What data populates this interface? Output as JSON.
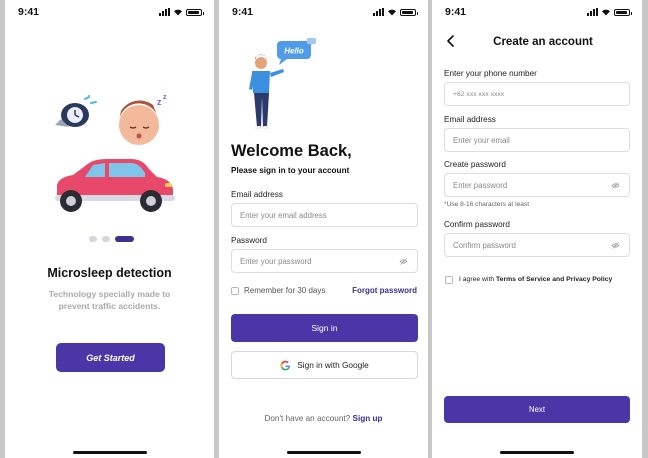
{
  "status_bar": {
    "time": "9:41"
  },
  "onboarding": {
    "title": "Microsleep detection",
    "description": "Technology specially made to prevent traffic accidents.",
    "cta_label": "Get Started",
    "page_count": 3,
    "active_page": 3
  },
  "signin": {
    "heading": "Welcome Back,",
    "subheading": "Please sign in to your account",
    "email_label": "Email address",
    "email_placeholder": "Enter your email address",
    "password_label": "Password",
    "password_placeholder": "Enter your password",
    "remember_label": "Remember for 30 days",
    "forgot_label": "Forgot password",
    "signin_label": "Sign in",
    "google_label": "Sign in with Google",
    "no_account_text": "Don't have an account?",
    "signup_label": "Sign up",
    "bubble_text": "Hello"
  },
  "create_account": {
    "heading": "Create an account",
    "phone_label": "Enter your phone number",
    "phone_placeholder": "+62 xxx xxx xxxx",
    "email_label": "Email address",
    "email_placeholder": "Enter your email",
    "create_password_label": "Create password",
    "create_password_placeholder": "Enter password",
    "password_hint": "*Use 8-16 characters at least",
    "confirm_password_label": "Confirm password",
    "confirm_password_placeholder": "Confirm password",
    "agree_prefix": "I agree with",
    "agree_terms": "Terms of Service and Privacy Policy",
    "next_label": "Next"
  },
  "colors": {
    "primary": "#4b36a8",
    "link": "#3f2d92",
    "background": "#c8c8c8"
  },
  "icons": [
    "signal-icon",
    "wifi-icon",
    "battery-icon",
    "eye-off-icon",
    "google-icon",
    "back-arrow-icon"
  ]
}
